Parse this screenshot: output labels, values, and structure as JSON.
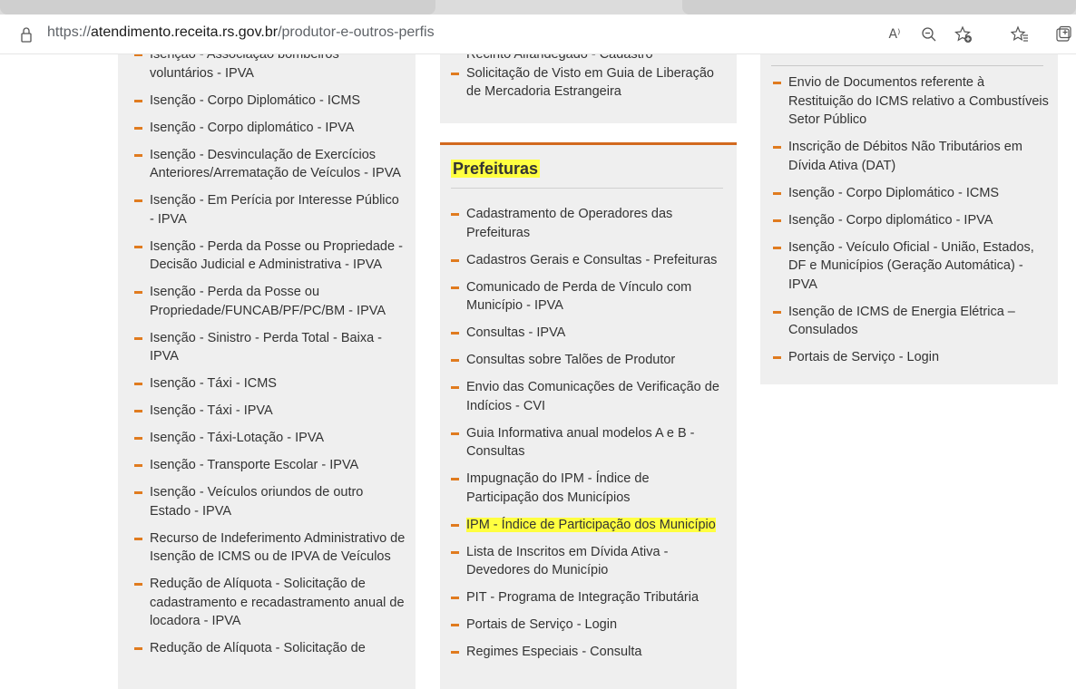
{
  "browser": {
    "url_prefix": "https://",
    "url_host": "atendimento.receita.rs.gov.br",
    "url_path": "/produtor-e-outros-perfis",
    "read_aloud_label": "A⁾",
    "icons": [
      "lock-icon",
      "read-aloud-icon",
      "zoom-out-icon",
      "add-favorite-icon",
      "favorites-icon",
      "collections-icon"
    ]
  },
  "column1": {
    "cut_top": "Isenção - Associação bombeiros",
    "items": [
      "voluntários - IPVA",
      "Isenção - Corpo Diplomático - ICMS",
      "Isenção - Corpo diplomático - IPVA",
      "Isenção - Desvinculação de Exercícios Anteriores/Arrematação de Veículos - IPVA",
      "Isenção - Em Perícia por Interesse Público - IPVA",
      "Isenção - Perda da Posse ou Propriedade - Decisão Judicial e Administrativa - IPVA",
      "Isenção - Perda da Posse ou Propriedade/FUNCAB/PF/PC/BM - IPVA",
      "Isenção - Sinistro - Perda Total - Baixa - IPVA",
      "Isenção - Táxi - ICMS",
      "Isenção - Táxi - IPVA",
      "Isenção - Táxi-Lotação - IPVA",
      "Isenção - Transporte Escolar - IPVA",
      "Isenção - Veículos oriundos de outro Estado - IPVA",
      "Recurso de Indeferimento Administrativo de Isenção de ICMS ou de IPVA de Veículos",
      "Redução de Alíquota - Solicitação de cadastramento e recadastramento anual de locadora - IPVA",
      "Redução de Alíquota - Solicitação de"
    ]
  },
  "column2_top": {
    "cut_top": "Recinto Alfandegado - Cadastro",
    "items": [
      "Solicitação de Visto em Guia de Liberação de Mercadoria Estrangeira"
    ]
  },
  "column2": {
    "title": "Prefeituras",
    "items": [
      "Cadastramento de Operadores das Prefeituras",
      "Cadastros Gerais e Consultas - Prefeituras",
      "Comunicado de Perda de Vínculo com Município - IPVA",
      "Consultas - IPVA",
      "Consultas sobre Talões de Produtor",
      "Envio das Comunicações de Verificação de Indícios - CVI",
      "Guia Informativa anual modelos A e B - Consultas",
      "Impugnação do IPM - Índice de Participação dos Municípios",
      "IPM - Índice de Participação dos Município",
      "Lista de Inscritos em Dívida Ativa - Devedores do Município",
      "PIT - Programa de Integração Tributária",
      "Portais de Serviço - Login",
      "Regimes Especiais - Consulta"
    ],
    "highlighted_item": "IPM - Índice de Participação dos Município"
  },
  "column3": {
    "items": [
      "Envio de Documentos referente à Restituição do ICMS relativo a Combustíveis Setor Público",
      "Inscrição de Débitos Não Tributários em Dívida Ativa (DAT)",
      "Isenção - Corpo Diplomático - ICMS",
      "Isenção - Corpo diplomático - IPVA",
      "Isenção - Veículo Oficial - União, Estados, DF e Municípios (Geração Automática) - IPVA",
      "Isenção de ICMS de Energia Elétrica – Consulados",
      "Portais de Serviço - Login"
    ]
  },
  "colors": {
    "accent_dash": "#e07b1f",
    "section_border": "#d2691e",
    "highlight": "#ffff40",
    "panel_bg": "#efefef"
  }
}
